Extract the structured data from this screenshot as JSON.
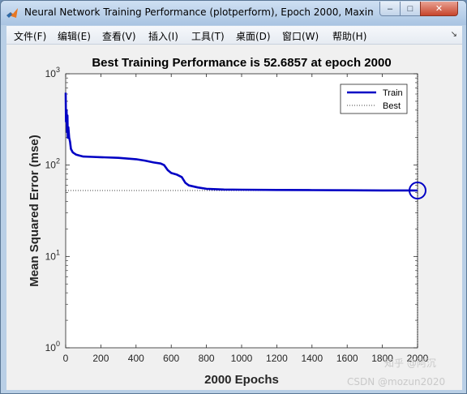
{
  "window": {
    "title": "Neural Network Training Performance (plotperform), Epoch 2000, Maxim...",
    "min_glyph": "–",
    "max_glyph": "□",
    "close_glyph": "✕"
  },
  "menu": {
    "items": [
      "文件(F)",
      "编辑(E)",
      "查看(V)",
      "插入(I)",
      "工具(T)",
      "桌面(D)",
      "窗口(W)",
      "帮助(H)"
    ],
    "overflow_glyph": "↘"
  },
  "watermark": {
    "line1": "知乎 @阿沉",
    "line2": "CSDN @mozun2020"
  },
  "colors": {
    "train": "#0000c4",
    "best": "#000000",
    "axes_bg": "#ffffff",
    "figure_bg": "#f0f0f0"
  },
  "chart_data": {
    "type": "line",
    "title": "Best Training Performance is 52.6857 at epoch 2000",
    "xlabel": "2000 Epochs",
    "ylabel": "Mean Squared Error  (mse)",
    "xlim": [
      0,
      2000
    ],
    "ylim": [
      1,
      1000
    ],
    "yscale": "log",
    "xticks": [
      0,
      200,
      400,
      600,
      800,
      1000,
      1200,
      1400,
      1600,
      1800,
      2000
    ],
    "yticks": [
      1,
      10,
      100,
      1000
    ],
    "ytick_labels": [
      {
        "base": "10",
        "exp": "0"
      },
      {
        "base": "10",
        "exp": "1"
      },
      {
        "base": "10",
        "exp": "2"
      },
      {
        "base": "10",
        "exp": "3"
      }
    ],
    "grid": false,
    "legend_position": "top-right",
    "series": [
      {
        "name": "Train",
        "style": "solid",
        "x": [
          0,
          2,
          5,
          8,
          10,
          12,
          15,
          20,
          25,
          30,
          40,
          60,
          80,
          100,
          150,
          200,
          300,
          400,
          450,
          500,
          540,
          560,
          580,
          600,
          630,
          660,
          680,
          700,
          750,
          800,
          900,
          1000,
          1200,
          1400,
          1600,
          1800,
          2000
        ],
        "y": [
          620,
          300,
          400,
          230,
          350,
          200,
          260,
          200,
          180,
          150,
          138,
          130,
          127,
          124,
          123,
          122,
          120,
          116,
          112,
          107,
          104,
          100,
          88,
          82,
          79,
          74,
          64,
          60,
          57,
          55,
          54,
          53.8,
          53.5,
          53.2,
          53,
          52.85,
          52.6857
        ]
      },
      {
        "name": "Best",
        "style": "dotted",
        "hline": 52.6857,
        "vline": 2000
      }
    ],
    "best_marker": {
      "x": 2000,
      "y": 52.6857
    }
  }
}
